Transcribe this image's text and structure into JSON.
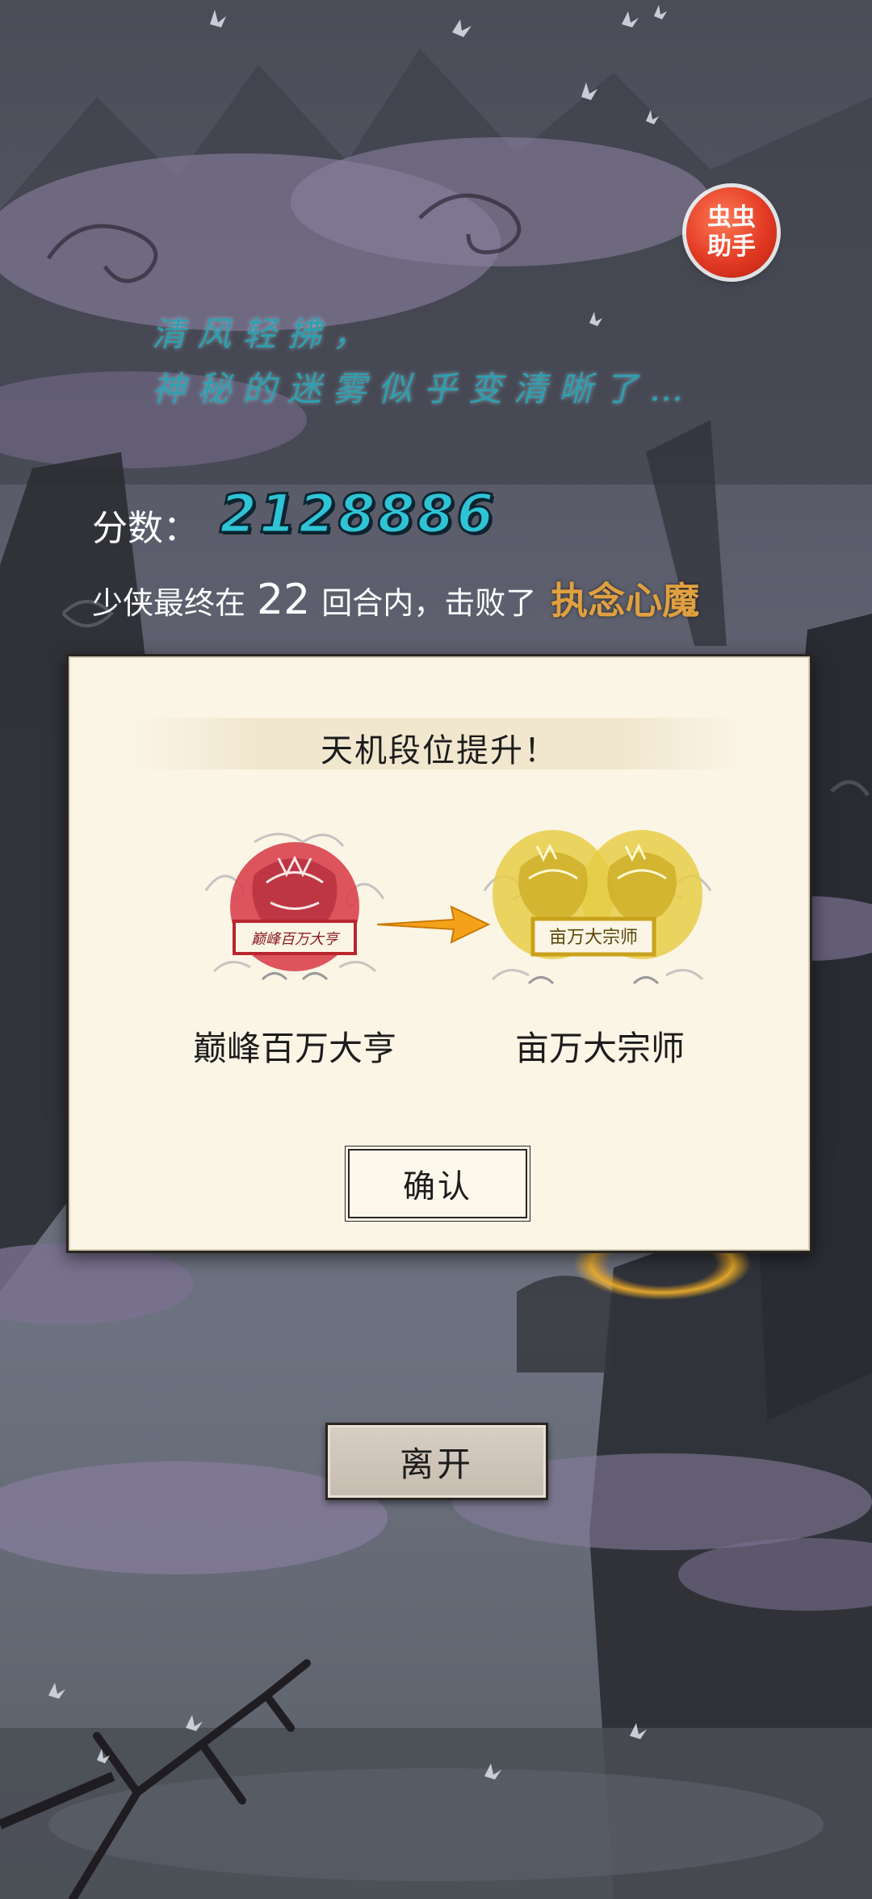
{
  "assistant_badge": {
    "label": "虫虫\n助手"
  },
  "poem": {
    "line1": "清风轻拂，",
    "line2": "神秘的迷雾似乎变清晰了…"
  },
  "score": {
    "label": "分数：",
    "value": "2128886"
  },
  "result": {
    "prefix": "少侠最终在",
    "rounds": "22",
    "middle": "回合内，击败了",
    "boss": "执念心魔"
  },
  "dialog": {
    "title": "天机段位提升！",
    "old_rank": {
      "name": "巅峰百万大亨",
      "seal_text": "巅峰百万大亨",
      "color": "#d9424e"
    },
    "new_rank": {
      "name": "亩万大宗师",
      "seal_text": "亩万大宗师",
      "color": "#d8b62c"
    },
    "arrow_color": "#f3a21a",
    "confirm_label": "确认"
  },
  "leave_label": "离开"
}
